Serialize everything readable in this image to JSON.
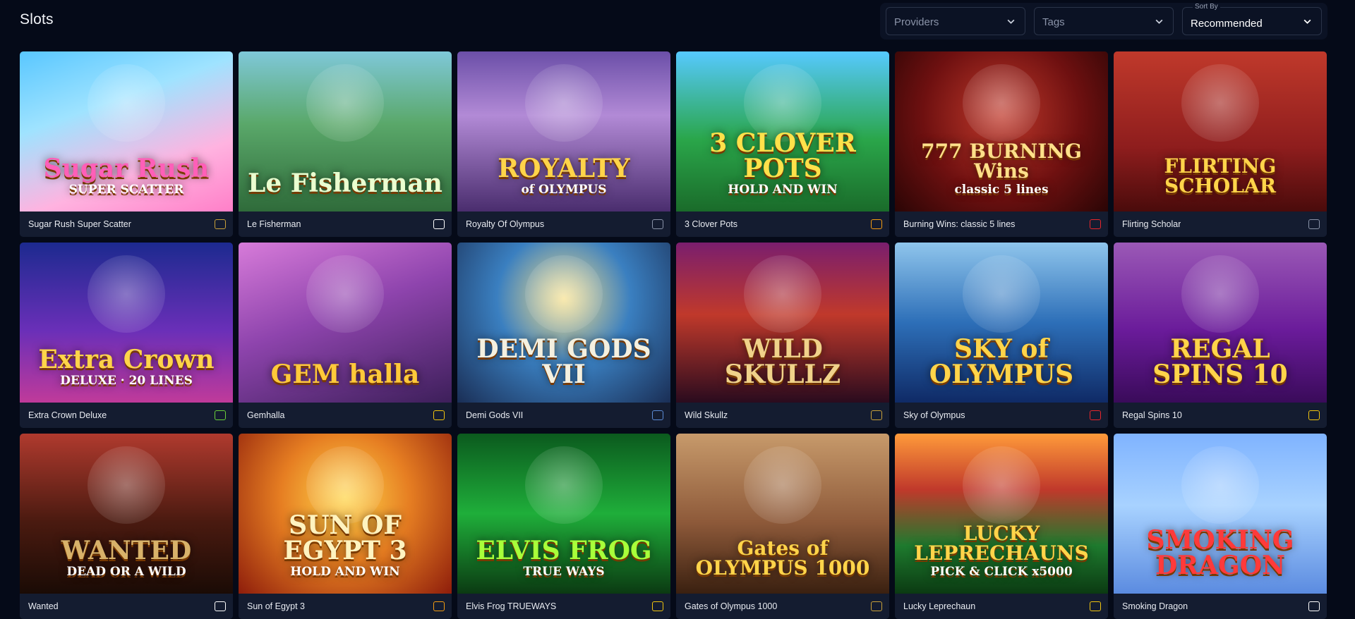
{
  "page": {
    "title": "Slots"
  },
  "filters": {
    "providers": {
      "value": "Providers"
    },
    "tags": {
      "value": "Tags"
    },
    "sort": {
      "caption": "Sort By",
      "value": "Recommended"
    }
  },
  "colors": {
    "background": "#050a18",
    "card_footer": "#141c30",
    "select_border": "#2a3348"
  },
  "games": [
    {
      "name": "Sugar Rush Super Scatter",
      "art": "Sugar Rush",
      "art_sub": "SUPER SCATTER",
      "bg": "linear-gradient(160deg,#59c7ff 0%,#9fe3ff 35%,#ffb3e0 70%,#ff7fc8 100%)",
      "title_color": "#ff5fb8",
      "provider_icon": "pragmatic-play-icon",
      "provider_color": "#c9a13a"
    },
    {
      "name": "Le Fisherman",
      "art": "Le Fisherman",
      "art_sub": "",
      "bg": "linear-gradient(180deg,#7fc8d9 0%,#5aa86a 45%,#2f6b3a 100%)",
      "title_color": "#eaffd0",
      "provider_icon": "hacksaw-icon",
      "provider_color": "#ffffff"
    },
    {
      "name": "Royalty Of Olympus",
      "art": "ROYALTY",
      "art_sub": "of OLYMPUS",
      "bg": "linear-gradient(180deg,#6b4fa8 0%,#b28ad6 40%,#4a2d6e 100%)",
      "title_color": "#ffd44a",
      "provider_icon": "grid-dots-icon",
      "provider_color": "#8a93a8"
    },
    {
      "name": "3 Clover Pots",
      "art": "3 CLOVER POTS",
      "art_sub": "HOLD AND WIN",
      "bg": "linear-gradient(180deg,#56c9ff 0%,#2aa64a 55%,#1a6b2a 100%)",
      "title_color": "#ffe14a",
      "provider_icon": "booongo-icon",
      "provider_color": "#f39c12"
    },
    {
      "name": "Burning Wins: classic 5 lines",
      "art": "777 BURNING Wins",
      "art_sub": "classic 5 lines",
      "bg": "radial-gradient(circle at 50% 40%,#c0392b 0%,#6e1010 55%,#2a0505 100%)",
      "title_color": "#ffe08a",
      "provider_icon": "playson-icon",
      "provider_color": "#e8262b"
    },
    {
      "name": "Flirting Scholar",
      "art": "FLIRTING SCHOLAR",
      "art_sub": "",
      "bg": "linear-gradient(180deg,#c0392b 0%,#8e1d1d 60%,#4a0b0b 100%)",
      "title_color": "#ffd44a",
      "provider_icon": "pg-soft-icon",
      "provider_color": "#8a93a8"
    },
    {
      "name": "Extra Crown Deluxe",
      "art": "Extra Crown",
      "art_sub": "DELUXE · 20 LINES",
      "bg": "linear-gradient(180deg,#1c2a8f 0%,#6a2fb8 55%,#c03a9a 100%)",
      "title_color": "#ffd44a",
      "provider_icon": "eye-icon",
      "provider_color": "#6bd13a"
    },
    {
      "name": "Gemhalla",
      "art": "GEM halla",
      "art_sub": "",
      "bg": "linear-gradient(160deg,#d77bd9 0%,#8e44ad 45%,#3d1f5a 100%)",
      "title_color": "#ffc93a",
      "provider_icon": "booongo-icon",
      "provider_color": "#f1c40f"
    },
    {
      "name": "Demi Gods VII",
      "art": "DEMI GODS VII",
      "art_sub": "",
      "bg": "radial-gradient(circle at 50% 35%,#f7e08a 0%,#3a7fc0 45%,#1a2e55 100%)",
      "title_color": "#f4f0e0",
      "provider_icon": "spinomenal-icon",
      "provider_color": "#5b8bd6"
    },
    {
      "name": "Wild Skullz",
      "art": "WILD SKULLZ",
      "art_sub": "",
      "bg": "linear-gradient(180deg,#7a1e6e 0%,#c0392b 45%,#2a0b1e 100%)",
      "title_color": "#f0d28a",
      "provider_icon": "pragmatic-play-icon",
      "provider_color": "#c9a13a"
    },
    {
      "name": "Sky of Olympus",
      "art": "SKY of OLYMPUS",
      "art_sub": "",
      "bg": "linear-gradient(180deg,#8fc5ec 0%,#2d6fb8 50%,#0f2a66 100%)",
      "title_color": "#ffd44a",
      "provider_icon": "fazi-icon",
      "provider_color": "#e8262b"
    },
    {
      "name": "Regal Spins 10",
      "art": "REGAL SPINS 10",
      "art_sub": "",
      "bg": "linear-gradient(180deg,#9b59b6 0%,#6a1b9a 55%,#3a0b5a 100%)",
      "title_color": "#ffd44a",
      "provider_icon": "smile-icon",
      "provider_color": "#f1c40f"
    },
    {
      "name": "Wanted",
      "art": "WANTED",
      "art_sub": "DEAD OR A WILD",
      "bg": "linear-gradient(180deg,#b03a2e 0%,#4a1a10 55%,#1a0b05 100%)",
      "title_color": "#d8b26a",
      "provider_icon": "hacksaw-icon",
      "provider_color": "#ffffff"
    },
    {
      "name": "Sun of Egypt 3",
      "art": "SUN OF EGYPT 3",
      "art_sub": "HOLD AND WIN",
      "bg": "radial-gradient(circle at 50% 40%,#ffd54a 0%,#e67e22 45%,#8e1d0b 100%)",
      "title_color": "#fff3c0",
      "provider_icon": "booongo-icon",
      "provider_color": "#f39c12"
    },
    {
      "name": "Elvis Frog TRUEWAYS",
      "art": "ELVIS FROG",
      "art_sub": "TRUE WAYS",
      "bg": "linear-gradient(180deg,#0b5a1e 0%,#1fae3a 50%,#0b3a12 100%)",
      "title_color": "#a8ff3a",
      "provider_icon": "bgaming-icon",
      "provider_color": "#f1c40f"
    },
    {
      "name": "Gates of Olympus 1000",
      "art": "Gates of OLYMPUS 1000",
      "art_sub": "",
      "bg": "linear-gradient(180deg,#c79a6b 0%,#8e5a3a 55%,#3a2010 100%)",
      "title_color": "#ffd44a",
      "provider_icon": "pragmatic-play-icon",
      "provider_color": "#c9a13a"
    },
    {
      "name": "Lucky Leprechaun",
      "art": "LUCKY LEPRECHAUNS",
      "art_sub": "PICK & CLICK x5000",
      "bg": "linear-gradient(180deg,#ff9a3a 0%,#c0392b 35%,#1e7a2e 70%,#0b3a12 100%)",
      "title_color": "#ffd44a",
      "provider_icon": "gear-icon",
      "provider_color": "#f1c40f"
    },
    {
      "name": "Smoking Dragon",
      "art": "SMOKING DRAGON",
      "art_sub": "",
      "bg": "linear-gradient(180deg,#7fb3ff 0%,#a8d2ff 45%,#5b8be0 100%)",
      "title_color": "#ff3a3a",
      "provider_icon": "hacksaw-icon",
      "provider_color": "#ffffff"
    }
  ]
}
